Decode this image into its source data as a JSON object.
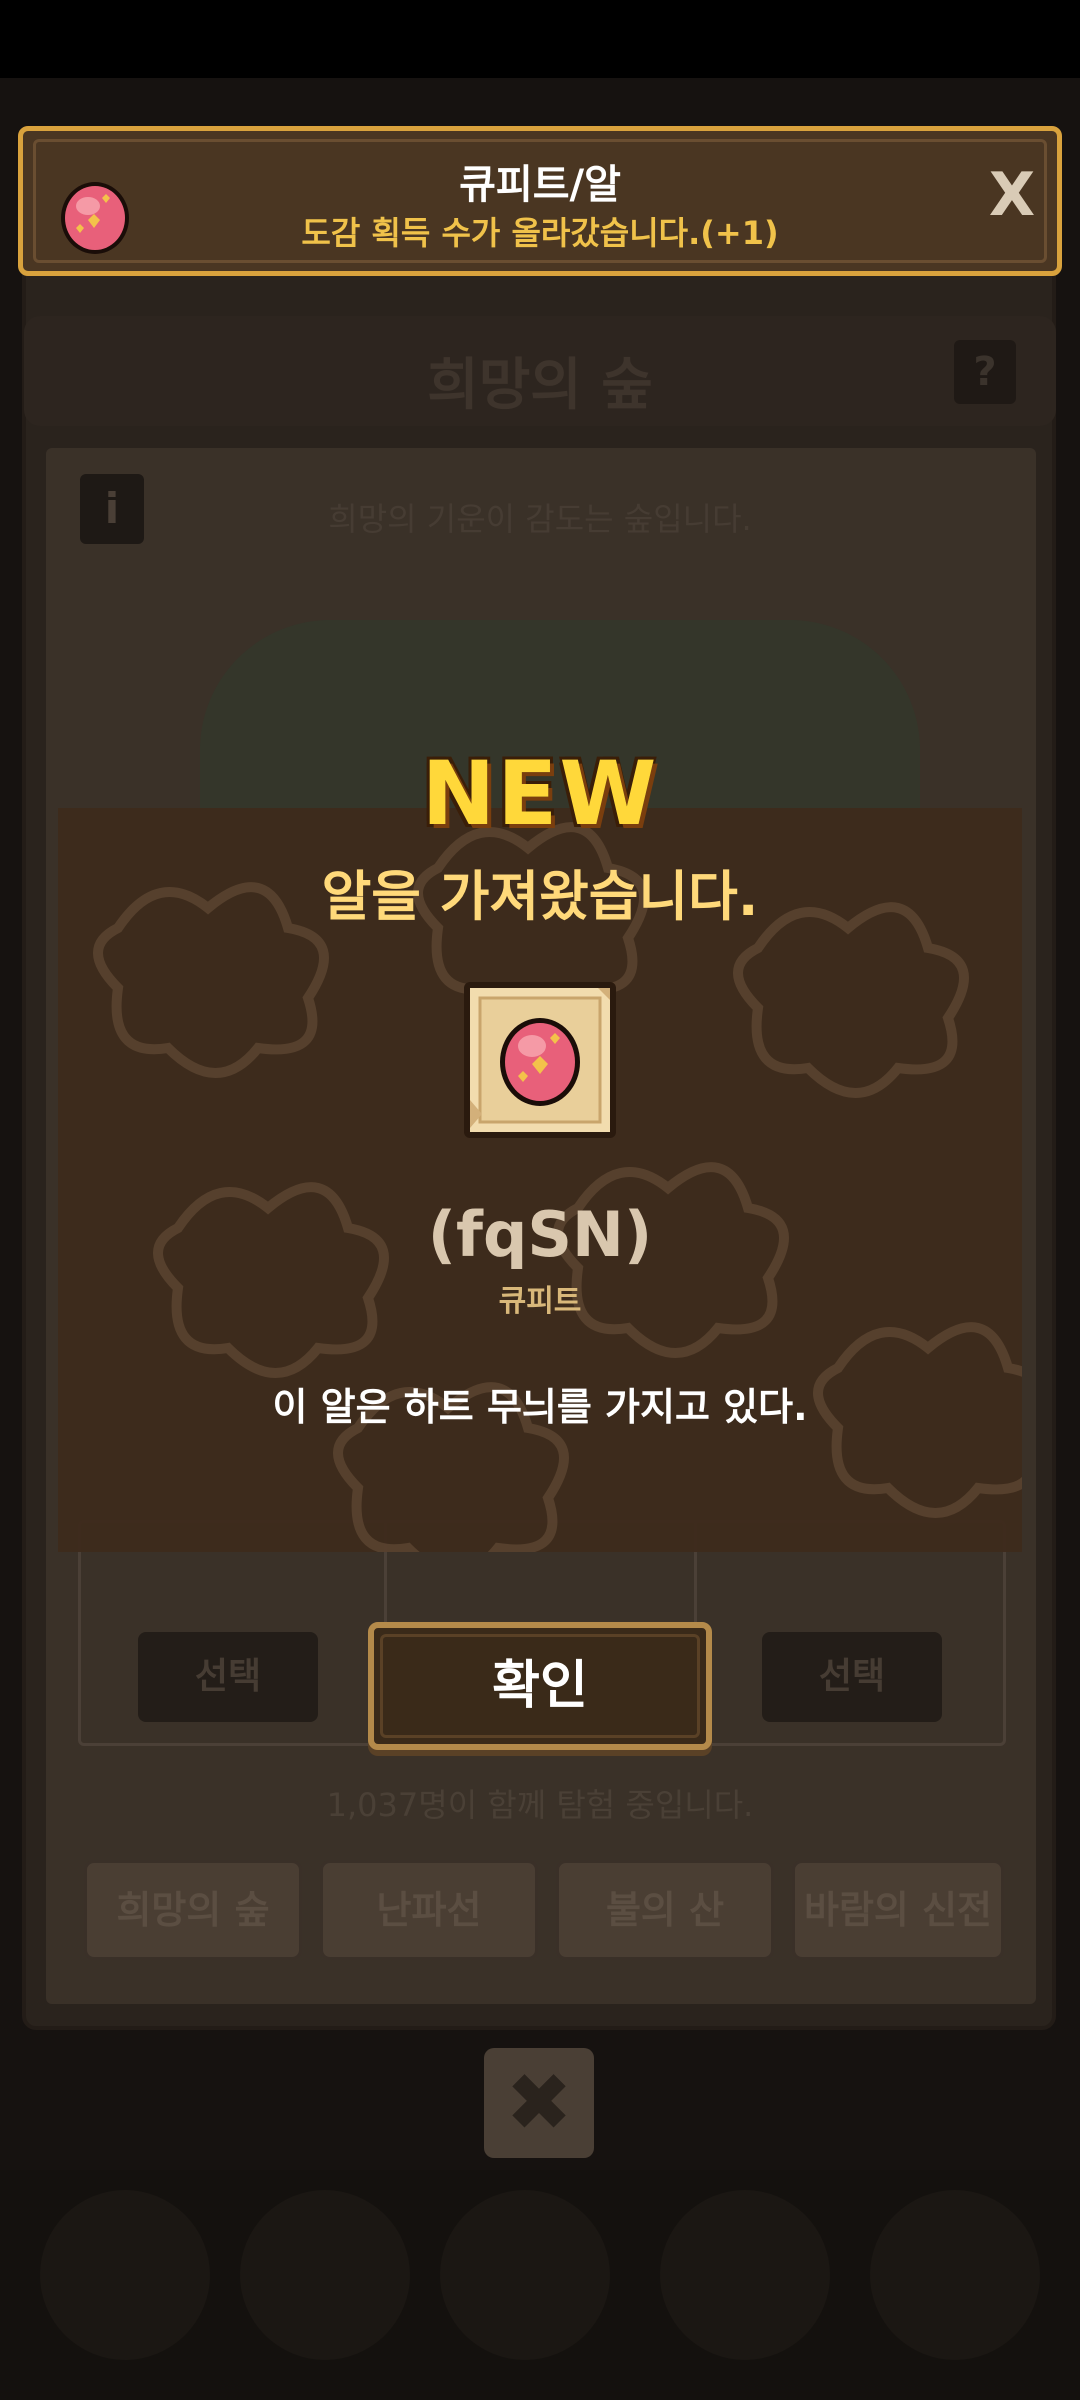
{
  "background": {
    "title": "희망의 숲",
    "help_icon": "?",
    "info_icon": "i",
    "description": "희망의 기운이 감도는 숲입니다.",
    "select_left": "선택",
    "select_right": "선택",
    "player_count": "1,037명이 함께 탐험 중입니다.",
    "tabs": [
      "희망의 숲",
      "난파선",
      "불의 산",
      "바람의 신전"
    ]
  },
  "banner": {
    "title": "큐피트/알",
    "subtitle": "도감 획득 수가 올라갔습니다.(+1)",
    "close_label": "X",
    "icon": "pink-heart-egg-icon"
  },
  "modal": {
    "badge": "NEW",
    "heading": "알을 가져왔습니다.",
    "item_code": "(fqSN)",
    "item_name": "큐피트",
    "item_description": "이 알은 하트 무늬를 가지고 있다.",
    "confirm_label": "확인",
    "egg_icon": "pink-heart-egg-icon"
  },
  "colors": {
    "banner_border": "#d9a23d",
    "new_badge": "#ffd83a",
    "heading": "#ffd97a",
    "egg_pink": "#e8607a"
  }
}
